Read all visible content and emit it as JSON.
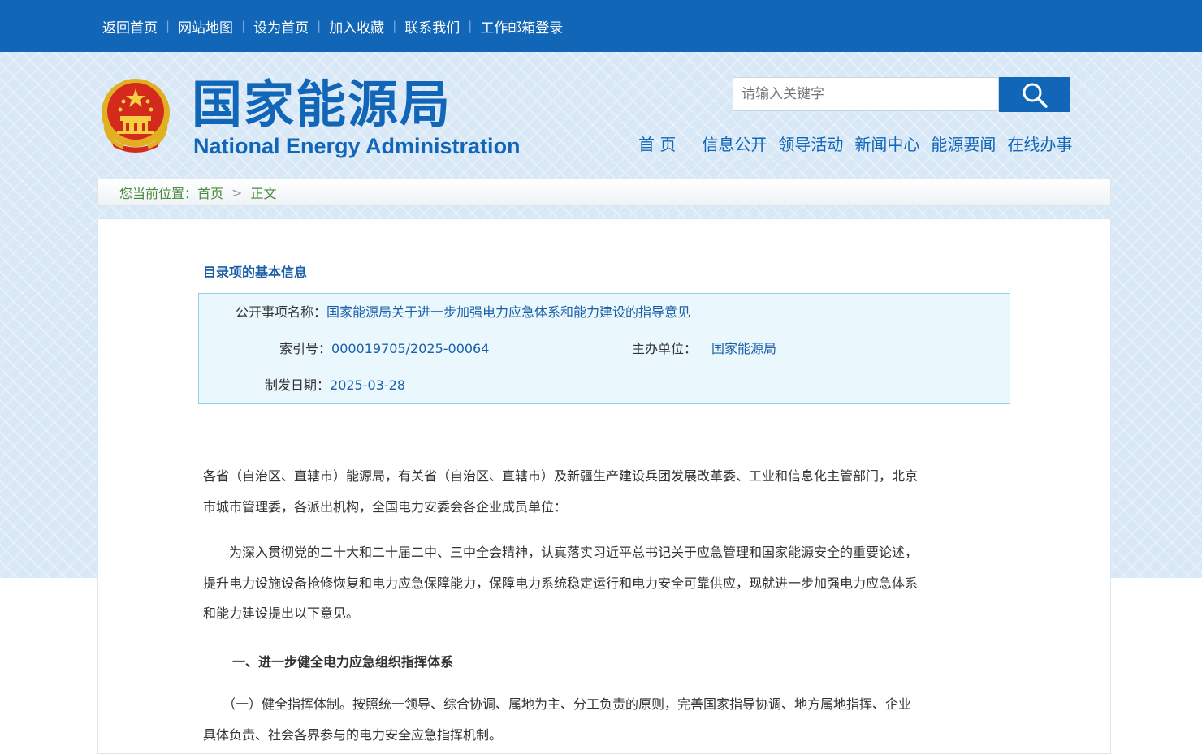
{
  "top_links": [
    "返回首页",
    "网站地图",
    "设为首页",
    "加入收藏",
    "联系我们",
    "工作邮箱登录"
  ],
  "logo": {
    "cn": "国家能源局",
    "en": "National Energy Administration"
  },
  "search": {
    "placeholder": "请输入关键字"
  },
  "nav": [
    "首 页",
    "信息公开",
    "领导活动",
    "新闻中心",
    "能源要闻",
    "在线办事"
  ],
  "breadcrumb": {
    "label": "您当前位置：",
    "home": "首页",
    "current": "正文"
  },
  "meta": {
    "section_title": "目录项的基本信息",
    "name_label": "公开事项名称：",
    "name_value": "国家能源局关于进一步加强电力应急体系和能力建设的指导意见",
    "index_label": "索引号：",
    "index_value": "000019705/2025-00064",
    "org_label": "主办单位：",
    "org_value": "国家能源局",
    "date_label": "制发日期：",
    "date_value": "2025-03-28"
  },
  "article": {
    "p1_line1": "各省（自治区、直辖市）能源局，有关省（自治区、直辖市）及新疆生产建设兵团发展改革委、工业和信息化主管部门，北京",
    "p1_line2": "市城市管理委，各派出机构，全国电力安委会各企业成员单位：",
    "p2_line1": "　　为深入贯彻党的二十大和二十届二中、三中全会精神，认真落实习近平总书记关于应急管理和国家能源安全的重要论述，",
    "p2_line2": "提升电力设施设备抢修恢复和电力应急保障能力，保障电力系统稳定运行和电力安全可靠供应，现就进一步加强电力应急体系",
    "p2_line3": "和能力建设提出以下意见。",
    "h1": "一、进一步健全电力应急组织指挥体系",
    "p3_line1": "　　（一）健全指挥体制。按照统一领导、综合协调、属地为主、分工负责的原则，完善国家指导协调、地方属地指挥、企业",
    "p3_line2": "具体负责、社会各界参与的电力安全应急指挥机制。"
  },
  "colors": {
    "brand": "#1266b8",
    "link": "#1a5fa8",
    "breadcrumb": "#4a8a3a",
    "meta_bg": "#eaf8fd"
  }
}
